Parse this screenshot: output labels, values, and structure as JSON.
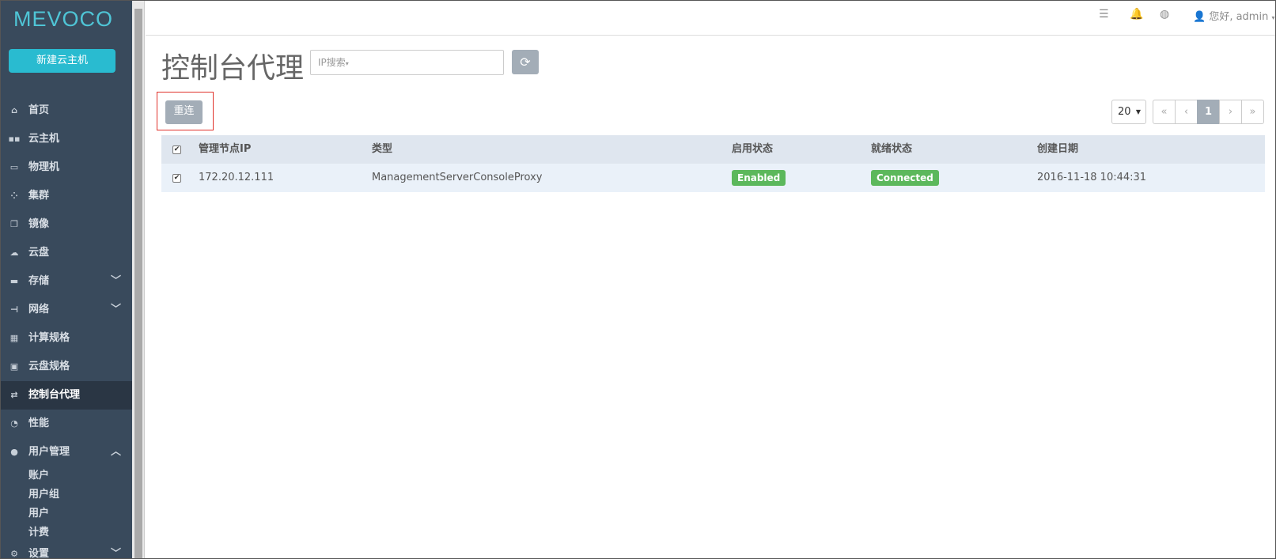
{
  "brand": {
    "logo": "MEVOCO",
    "accent": "#29bbd0"
  },
  "sidebar": {
    "new_vm_label": "新建云主机",
    "items": [
      {
        "label": "首页",
        "icon": "home-icon"
      },
      {
        "label": "云主机",
        "icon": "vm-icon"
      },
      {
        "label": "物理机",
        "icon": "host-icon"
      },
      {
        "label": "集群",
        "icon": "cluster-icon"
      },
      {
        "label": "镜像",
        "icon": "image-icon"
      },
      {
        "label": "云盘",
        "icon": "cloud-disk-icon"
      },
      {
        "label": "存储",
        "icon": "storage-icon",
        "chevron": "down"
      },
      {
        "label": "网络",
        "icon": "network-icon",
        "chevron": "down"
      },
      {
        "label": "计算规格",
        "icon": "compute-spec-icon"
      },
      {
        "label": "云盘规格",
        "icon": "disk-spec-icon"
      },
      {
        "label": "控制台代理",
        "icon": "console-proxy-icon",
        "active": true
      },
      {
        "label": "性能",
        "icon": "performance-icon"
      },
      {
        "label": "用户管理",
        "icon": "user-icon",
        "chevron": "up"
      }
    ],
    "sub_items": [
      "账户",
      "用户组",
      "用户",
      "计费"
    ],
    "partial_item": {
      "label": "设置",
      "icon": "gear-icon"
    }
  },
  "topbar": {
    "icons": [
      "list-icon",
      "bell-icon",
      "globe-icon"
    ],
    "user_label": "您好, admin"
  },
  "page": {
    "title": "控制台代理",
    "search_placeholder": "IP搜索",
    "reconnect_label": "重连",
    "page_size": "20",
    "pager": [
      "«",
      "‹",
      "1",
      "›",
      "»"
    ],
    "current_page": "1"
  },
  "table": {
    "headers": [
      "管理节点IP",
      "类型",
      "启用状态",
      "就绪状态",
      "创建日期"
    ],
    "rows": [
      {
        "ip": "172.20.12.111",
        "type": "ManagementServerConsoleProxy",
        "state": "Enabled",
        "status": "Connected",
        "created": "2016-11-18 10:44:31"
      }
    ],
    "badge_color": "#5cb85c"
  }
}
